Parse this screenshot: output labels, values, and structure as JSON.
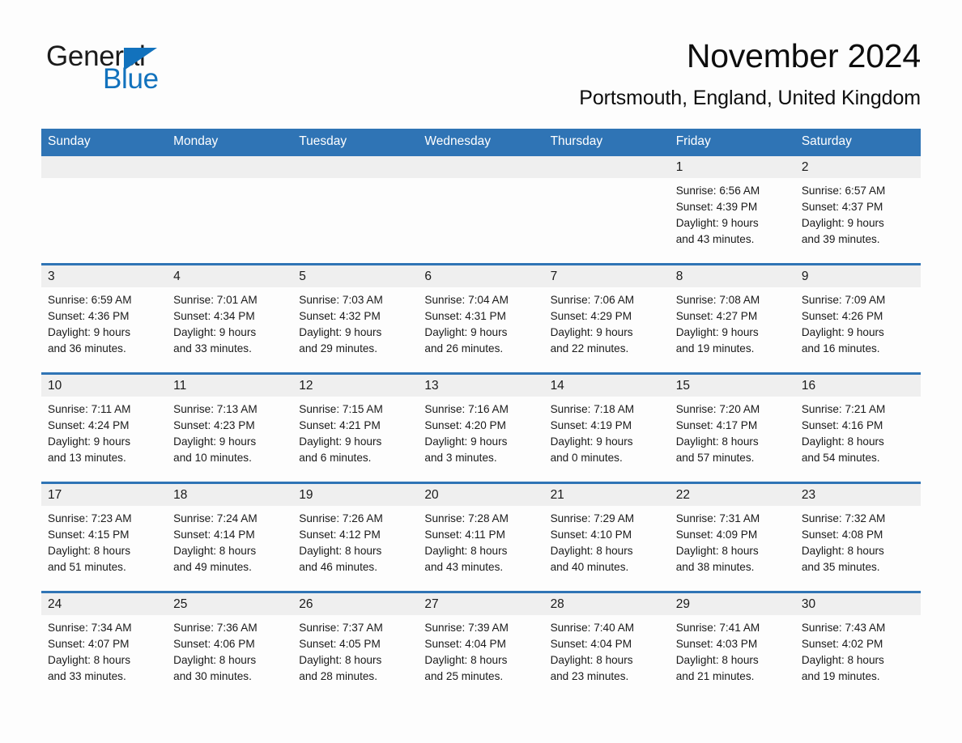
{
  "brand": {
    "name_part1": "General",
    "name_part2": "Blue",
    "triangle_color": "#1272bd",
    "accent_color": "#2f74b5"
  },
  "header": {
    "title": "November 2024",
    "subtitle": "Portsmouth, England, United Kingdom"
  },
  "calendar": {
    "weekdays": [
      "Sunday",
      "Monday",
      "Tuesday",
      "Wednesday",
      "Thursday",
      "Friday",
      "Saturday"
    ],
    "weeks": [
      [
        {
          "day": "",
          "sunrise": "",
          "sunset": "",
          "daylight_line1": "",
          "daylight_line2": ""
        },
        {
          "day": "",
          "sunrise": "",
          "sunset": "",
          "daylight_line1": "",
          "daylight_line2": ""
        },
        {
          "day": "",
          "sunrise": "",
          "sunset": "",
          "daylight_line1": "",
          "daylight_line2": ""
        },
        {
          "day": "",
          "sunrise": "",
          "sunset": "",
          "daylight_line1": "",
          "daylight_line2": ""
        },
        {
          "day": "",
          "sunrise": "",
          "sunset": "",
          "daylight_line1": "",
          "daylight_line2": ""
        },
        {
          "day": "1",
          "sunrise": "Sunrise: 6:56 AM",
          "sunset": "Sunset: 4:39 PM",
          "daylight_line1": "Daylight: 9 hours",
          "daylight_line2": "and 43 minutes."
        },
        {
          "day": "2",
          "sunrise": "Sunrise: 6:57 AM",
          "sunset": "Sunset: 4:37 PM",
          "daylight_line1": "Daylight: 9 hours",
          "daylight_line2": "and 39 minutes."
        }
      ],
      [
        {
          "day": "3",
          "sunrise": "Sunrise: 6:59 AM",
          "sunset": "Sunset: 4:36 PM",
          "daylight_line1": "Daylight: 9 hours",
          "daylight_line2": "and 36 minutes."
        },
        {
          "day": "4",
          "sunrise": "Sunrise: 7:01 AM",
          "sunset": "Sunset: 4:34 PM",
          "daylight_line1": "Daylight: 9 hours",
          "daylight_line2": "and 33 minutes."
        },
        {
          "day": "5",
          "sunrise": "Sunrise: 7:03 AM",
          "sunset": "Sunset: 4:32 PM",
          "daylight_line1": "Daylight: 9 hours",
          "daylight_line2": "and 29 minutes."
        },
        {
          "day": "6",
          "sunrise": "Sunrise: 7:04 AM",
          "sunset": "Sunset: 4:31 PM",
          "daylight_line1": "Daylight: 9 hours",
          "daylight_line2": "and 26 minutes."
        },
        {
          "day": "7",
          "sunrise": "Sunrise: 7:06 AM",
          "sunset": "Sunset: 4:29 PM",
          "daylight_line1": "Daylight: 9 hours",
          "daylight_line2": "and 22 minutes."
        },
        {
          "day": "8",
          "sunrise": "Sunrise: 7:08 AM",
          "sunset": "Sunset: 4:27 PM",
          "daylight_line1": "Daylight: 9 hours",
          "daylight_line2": "and 19 minutes."
        },
        {
          "day": "9",
          "sunrise": "Sunrise: 7:09 AM",
          "sunset": "Sunset: 4:26 PM",
          "daylight_line1": "Daylight: 9 hours",
          "daylight_line2": "and 16 minutes."
        }
      ],
      [
        {
          "day": "10",
          "sunrise": "Sunrise: 7:11 AM",
          "sunset": "Sunset: 4:24 PM",
          "daylight_line1": "Daylight: 9 hours",
          "daylight_line2": "and 13 minutes."
        },
        {
          "day": "11",
          "sunrise": "Sunrise: 7:13 AM",
          "sunset": "Sunset: 4:23 PM",
          "daylight_line1": "Daylight: 9 hours",
          "daylight_line2": "and 10 minutes."
        },
        {
          "day": "12",
          "sunrise": "Sunrise: 7:15 AM",
          "sunset": "Sunset: 4:21 PM",
          "daylight_line1": "Daylight: 9 hours",
          "daylight_line2": "and 6 minutes."
        },
        {
          "day": "13",
          "sunrise": "Sunrise: 7:16 AM",
          "sunset": "Sunset: 4:20 PM",
          "daylight_line1": "Daylight: 9 hours",
          "daylight_line2": "and 3 minutes."
        },
        {
          "day": "14",
          "sunrise": "Sunrise: 7:18 AM",
          "sunset": "Sunset: 4:19 PM",
          "daylight_line1": "Daylight: 9 hours",
          "daylight_line2": "and 0 minutes."
        },
        {
          "day": "15",
          "sunrise": "Sunrise: 7:20 AM",
          "sunset": "Sunset: 4:17 PM",
          "daylight_line1": "Daylight: 8 hours",
          "daylight_line2": "and 57 minutes."
        },
        {
          "day": "16",
          "sunrise": "Sunrise: 7:21 AM",
          "sunset": "Sunset: 4:16 PM",
          "daylight_line1": "Daylight: 8 hours",
          "daylight_line2": "and 54 minutes."
        }
      ],
      [
        {
          "day": "17",
          "sunrise": "Sunrise: 7:23 AM",
          "sunset": "Sunset: 4:15 PM",
          "daylight_line1": "Daylight: 8 hours",
          "daylight_line2": "and 51 minutes."
        },
        {
          "day": "18",
          "sunrise": "Sunrise: 7:24 AM",
          "sunset": "Sunset: 4:14 PM",
          "daylight_line1": "Daylight: 8 hours",
          "daylight_line2": "and 49 minutes."
        },
        {
          "day": "19",
          "sunrise": "Sunrise: 7:26 AM",
          "sunset": "Sunset: 4:12 PM",
          "daylight_line1": "Daylight: 8 hours",
          "daylight_line2": "and 46 minutes."
        },
        {
          "day": "20",
          "sunrise": "Sunrise: 7:28 AM",
          "sunset": "Sunset: 4:11 PM",
          "daylight_line1": "Daylight: 8 hours",
          "daylight_line2": "and 43 minutes."
        },
        {
          "day": "21",
          "sunrise": "Sunrise: 7:29 AM",
          "sunset": "Sunset: 4:10 PM",
          "daylight_line1": "Daylight: 8 hours",
          "daylight_line2": "and 40 minutes."
        },
        {
          "day": "22",
          "sunrise": "Sunrise: 7:31 AM",
          "sunset": "Sunset: 4:09 PM",
          "daylight_line1": "Daylight: 8 hours",
          "daylight_line2": "and 38 minutes."
        },
        {
          "day": "23",
          "sunrise": "Sunrise: 7:32 AM",
          "sunset": "Sunset: 4:08 PM",
          "daylight_line1": "Daylight: 8 hours",
          "daylight_line2": "and 35 minutes."
        }
      ],
      [
        {
          "day": "24",
          "sunrise": "Sunrise: 7:34 AM",
          "sunset": "Sunset: 4:07 PM",
          "daylight_line1": "Daylight: 8 hours",
          "daylight_line2": "and 33 minutes."
        },
        {
          "day": "25",
          "sunrise": "Sunrise: 7:36 AM",
          "sunset": "Sunset: 4:06 PM",
          "daylight_line1": "Daylight: 8 hours",
          "daylight_line2": "and 30 minutes."
        },
        {
          "day": "26",
          "sunrise": "Sunrise: 7:37 AM",
          "sunset": "Sunset: 4:05 PM",
          "daylight_line1": "Daylight: 8 hours",
          "daylight_line2": "and 28 minutes."
        },
        {
          "day": "27",
          "sunrise": "Sunrise: 7:39 AM",
          "sunset": "Sunset: 4:04 PM",
          "daylight_line1": "Daylight: 8 hours",
          "daylight_line2": "and 25 minutes."
        },
        {
          "day": "28",
          "sunrise": "Sunrise: 7:40 AM",
          "sunset": "Sunset: 4:04 PM",
          "daylight_line1": "Daylight: 8 hours",
          "daylight_line2": "and 23 minutes."
        },
        {
          "day": "29",
          "sunrise": "Sunrise: 7:41 AM",
          "sunset": "Sunset: 4:03 PM",
          "daylight_line1": "Daylight: 8 hours",
          "daylight_line2": "and 21 minutes."
        },
        {
          "day": "30",
          "sunrise": "Sunrise: 7:43 AM",
          "sunset": "Sunset: 4:02 PM",
          "daylight_line1": "Daylight: 8 hours",
          "daylight_line2": "and 19 minutes."
        }
      ]
    ]
  }
}
